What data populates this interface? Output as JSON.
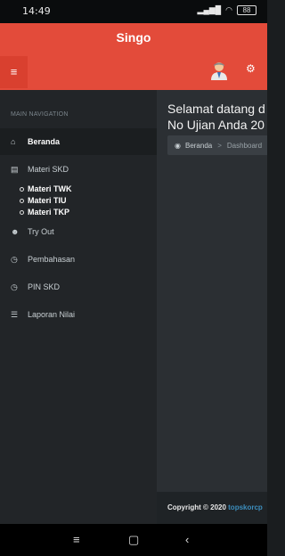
{
  "status": {
    "time": "14:49",
    "signal": "..ıll",
    "wifi": "wifi",
    "battery": "88"
  },
  "appbar": {
    "title": "Singo"
  },
  "sidebar": {
    "header": "MAIN NAVIGATION",
    "items": [
      {
        "label": "Beranda",
        "icon": "home-icon"
      },
      {
        "label": "Materi SKD",
        "icon": "book-icon"
      },
      {
        "label": "Try Out",
        "icon": "users-icon"
      },
      {
        "label": "Pembahasan",
        "icon": "clock-icon"
      },
      {
        "label": "PIN SKD",
        "icon": "clock-icon"
      },
      {
        "label": "Laporan Nilai",
        "icon": "list-icon"
      }
    ],
    "subitems": [
      "Materi TWK",
      "Materi TIU",
      "Materi TKP"
    ]
  },
  "content": {
    "welcome_line1": "Selamat datang d",
    "welcome_line2": "No Ujian Anda 20",
    "breadcrumb": {
      "home": "Beranda",
      "sep": ">",
      "current": "Dashboard"
    }
  },
  "footer": {
    "text": "Copyright © 2020 ",
    "link": "topskorcp"
  },
  "colors": {
    "accent": "#e34b3a",
    "sidebar": "#222528",
    "link": "#3c8dbc"
  }
}
